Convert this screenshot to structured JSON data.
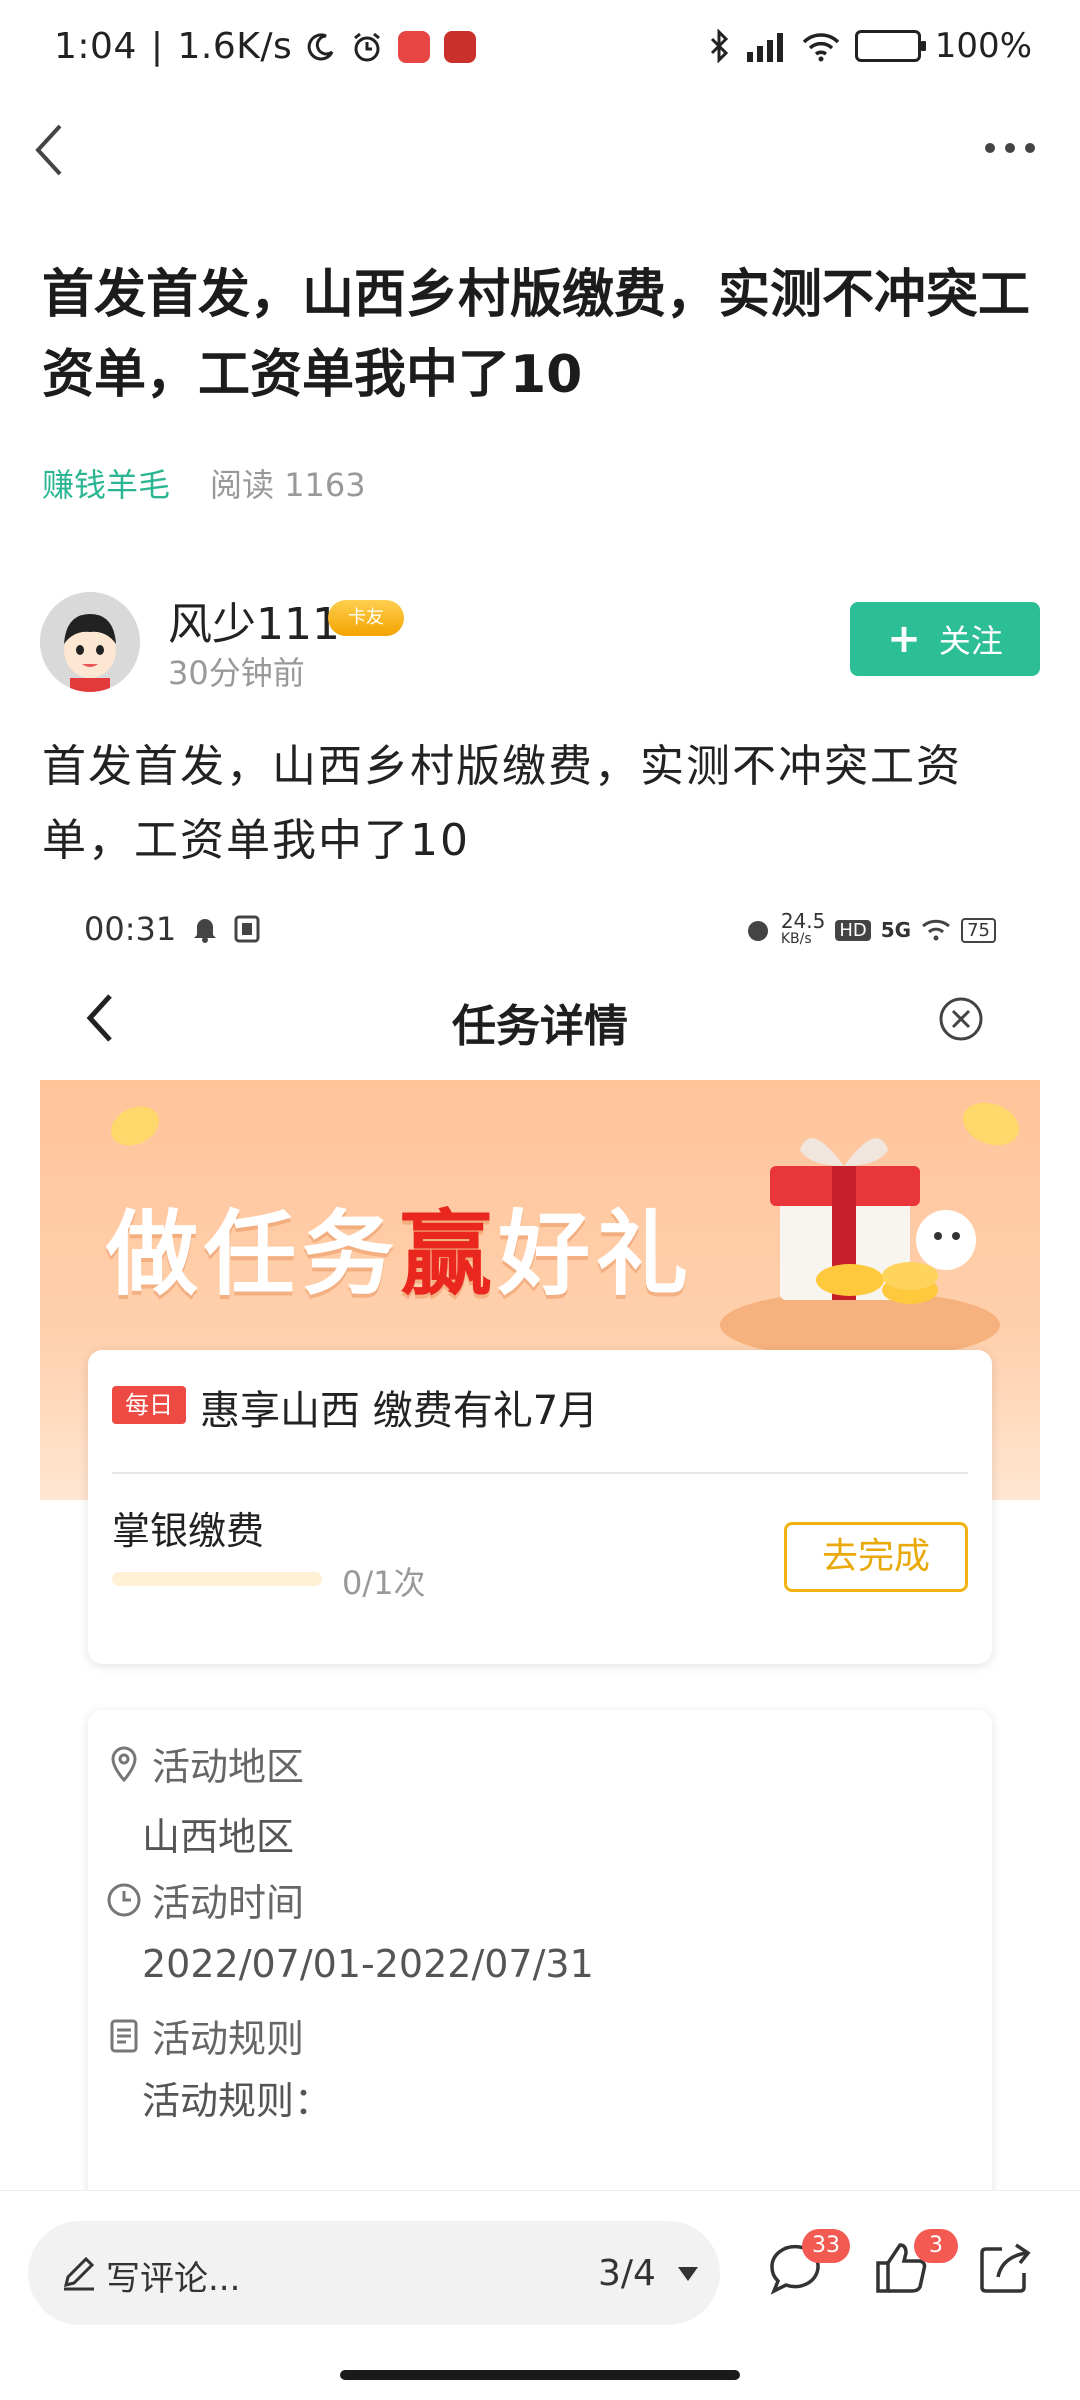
{
  "status_bar": {
    "time": "1:04",
    "speed": "1.6K/s",
    "battery": "100%"
  },
  "article": {
    "title": "首发首发，山西乡村版缴费，实测不冲突工资单，工资单我中了10",
    "category": "赚钱羊毛",
    "reads": "阅读 1163",
    "body": "首发首发，山西乡村版缴费，实测不冲突工资单，工资单我中了10"
  },
  "author": {
    "name": "风少111",
    "badge": "卡友",
    "time": "30分钟前",
    "follow_label": "关注"
  },
  "screenshot": {
    "status_time": "00:31",
    "net_speed": "24.5",
    "net_unit": "KB/s",
    "battery": "75",
    "title": "任务详情",
    "banner_text_a": "做任务",
    "banner_text_b": "赢",
    "banner_text_c": "好礼",
    "task": {
      "tag": "每日",
      "title": "惠享山西 缴费有礼7月",
      "name": "掌银缴费",
      "progress": "0/1次",
      "progress_fraction": 0,
      "button": "去完成"
    },
    "info": {
      "region_label": "活动地区",
      "region_value": "山西地区",
      "time_label": "活动时间",
      "time_value": "2022/07/01-2022/07/31",
      "rules_label": "活动规则",
      "rules_value": "活动规则："
    }
  },
  "bottom_bar": {
    "comment_placeholder": "写评论...",
    "page_indicator": "3/4",
    "comment_count": "33",
    "like_count": "3"
  },
  "colors": {
    "accent": "#2cbf95",
    "category": "#2bb592",
    "badge_red": "#f25a52",
    "go_button": "#f1b312"
  }
}
